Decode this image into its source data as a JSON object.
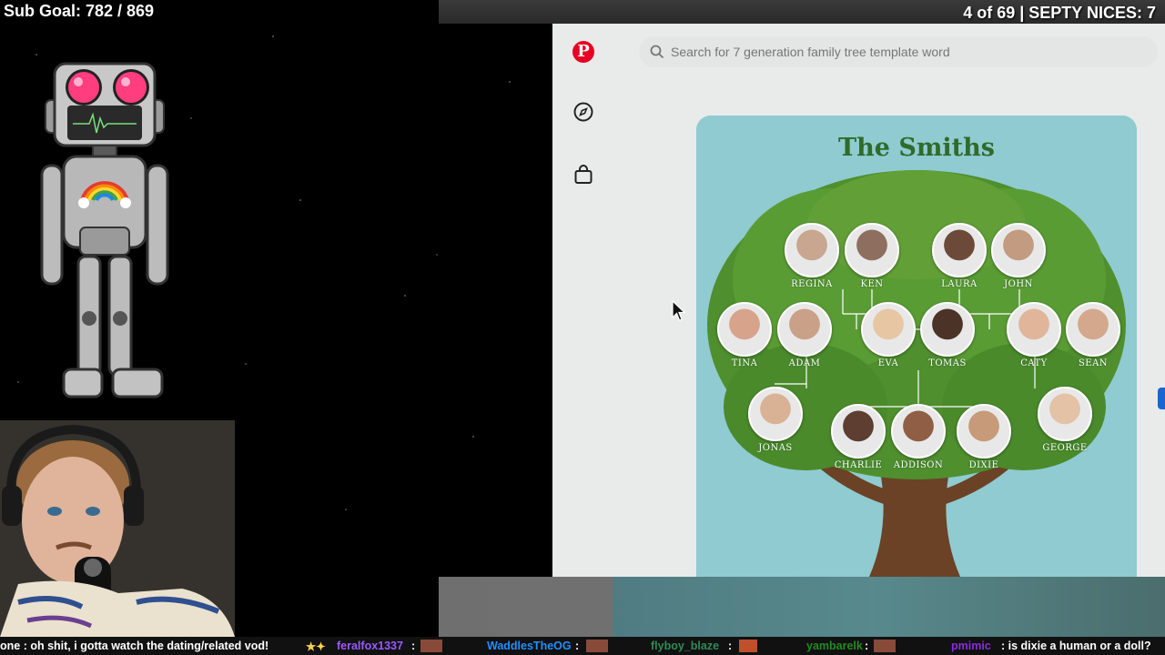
{
  "overlay": {
    "sub_goal": "Sub Goal: 782 / 869",
    "counter": "4 of 69 | SEPTY NICES: 7"
  },
  "pinterest": {
    "search_placeholder": "Search for 7 generation family tree template word",
    "brand_color": "#e60023",
    "sidebar_icons": [
      "pinterest-logo",
      "explore-compass-icon",
      "shopping-bag-icon"
    ],
    "pin": {
      "title": "The Smiths",
      "members": [
        {
          "name": "REGINA",
          "tone": "#c9a690"
        },
        {
          "name": "KEN",
          "tone": "#8e6f5f"
        },
        {
          "name": "LAURA",
          "tone": "#6c4a3a"
        },
        {
          "name": "JOHN",
          "tone": "#c39b80"
        },
        {
          "name": "TINA",
          "tone": "#d7a48b"
        },
        {
          "name": "ADAM",
          "tone": "#caa188"
        },
        {
          "name": "EVA",
          "tone": "#e7c6a3"
        },
        {
          "name": "TOMAS",
          "tone": "#4b3328"
        },
        {
          "name": "CATY",
          "tone": "#e0b59a"
        },
        {
          "name": "SEAN",
          "tone": "#d4a88c"
        },
        {
          "name": "JONAS",
          "tone": "#d9b296"
        },
        {
          "name": "CHARLIE",
          "tone": "#5d3e30"
        },
        {
          "name": "ADDISON",
          "tone": "#8f5e45"
        },
        {
          "name": "DIXIE",
          "tone": "#c79a7a"
        },
        {
          "name": "GEORGE",
          "tone": "#e3c2a6"
        }
      ]
    }
  },
  "chat": [
    {
      "user": "",
      "text": "one : oh shit, i gotta watch the dating/related vod!",
      "color": "#ffffff"
    },
    {
      "user": "feralfox1337",
      "text": ":",
      "color": "#9b59ff"
    },
    {
      "user": "WaddlesTheOG",
      "text": ":",
      "color": "#1e90ff"
    },
    {
      "user": "flyboy_blaze",
      "text": ":",
      "color": "#2e8b57"
    },
    {
      "user": "yambarelk",
      "text": ":",
      "color": "#228b22"
    },
    {
      "user": "pmimic",
      "text": ": is dixie a human or a doll?",
      "color": "#8a2be2"
    }
  ]
}
